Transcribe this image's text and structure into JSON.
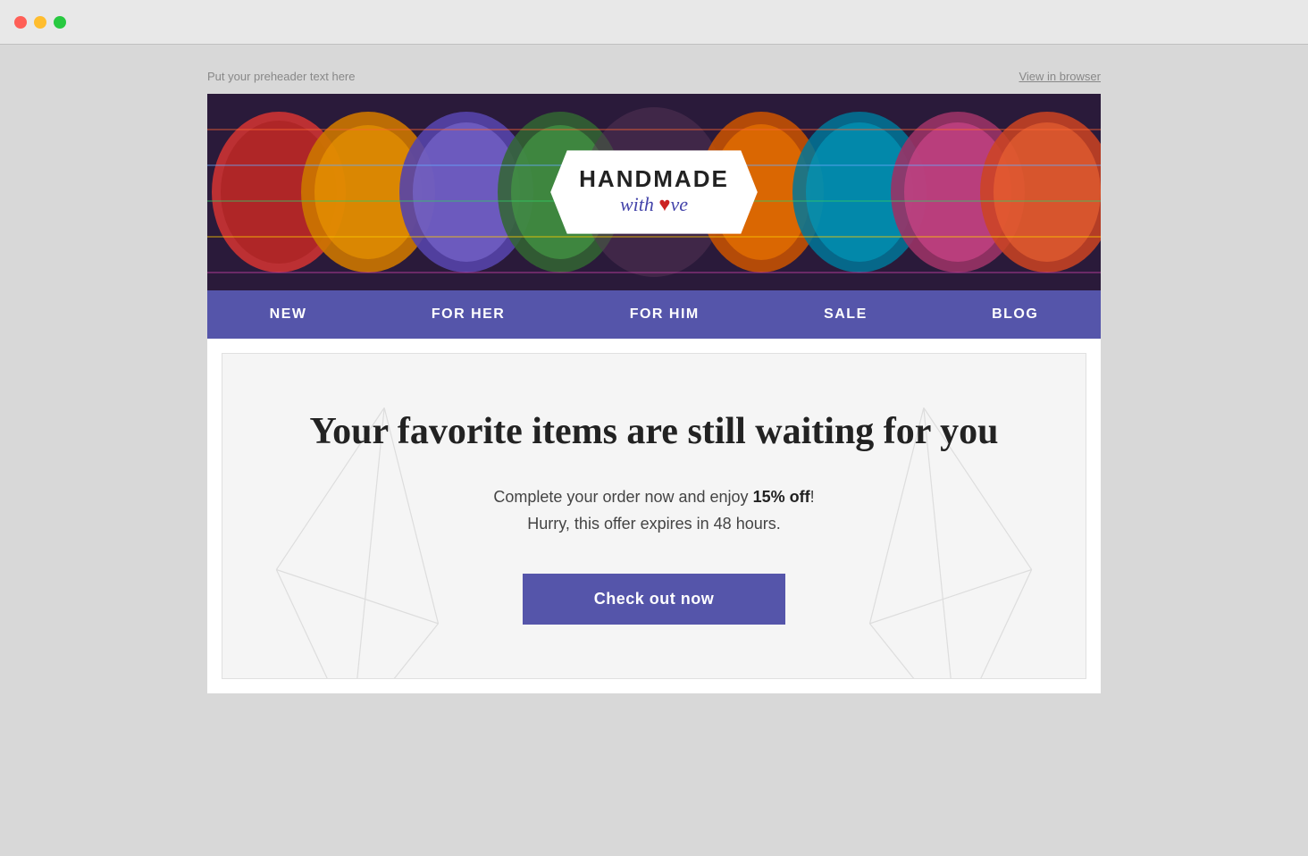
{
  "window": {
    "traffic_lights": [
      "red",
      "yellow",
      "green"
    ]
  },
  "preheader": {
    "text": "Put your preheader text here",
    "view_browser_label": "View in browser"
  },
  "hero": {
    "logo_title": "HANDMADE",
    "logo_subtitle_pre": "with ",
    "logo_heart": "♥",
    "logo_subtitle_post": "ve"
  },
  "nav": {
    "items": [
      {
        "label": "NEW"
      },
      {
        "label": "FOR HER"
      },
      {
        "label": "FOR HIM"
      },
      {
        "label": "SALE"
      },
      {
        "label": "BLOG"
      }
    ]
  },
  "main": {
    "heading": "Your favorite items are still waiting for you",
    "subtext_pre": "Complete your order now and enjoy ",
    "subtext_bold": "15% off",
    "subtext_exclaim": "!",
    "subtext_line2": "Hurry, this offer expires in 48 hours.",
    "cta_label": "Check out now"
  }
}
